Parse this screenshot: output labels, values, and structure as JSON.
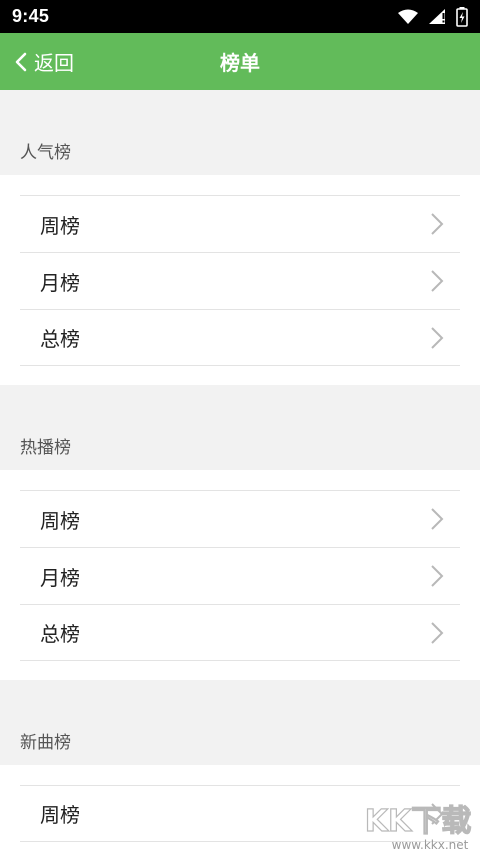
{
  "status_bar": {
    "time": "9:45"
  },
  "nav": {
    "back_label": "返回",
    "title": "榜单"
  },
  "sections": [
    {
      "title": "人气榜",
      "items": [
        {
          "label": "周榜"
        },
        {
          "label": "月榜"
        },
        {
          "label": "总榜"
        }
      ]
    },
    {
      "title": "热播榜",
      "items": [
        {
          "label": "周榜"
        },
        {
          "label": "月榜"
        },
        {
          "label": "总榜"
        }
      ]
    },
    {
      "title": "新曲榜",
      "items": [
        {
          "label": "周榜"
        }
      ]
    }
  ],
  "watermark": {
    "logo": "KK下载",
    "url": "www.kkx.net"
  },
  "colors": {
    "accent": "#62bb5a",
    "background": "#f2f2f2",
    "divider": "#e3e3e3",
    "chevron": "#b8b8b8"
  }
}
